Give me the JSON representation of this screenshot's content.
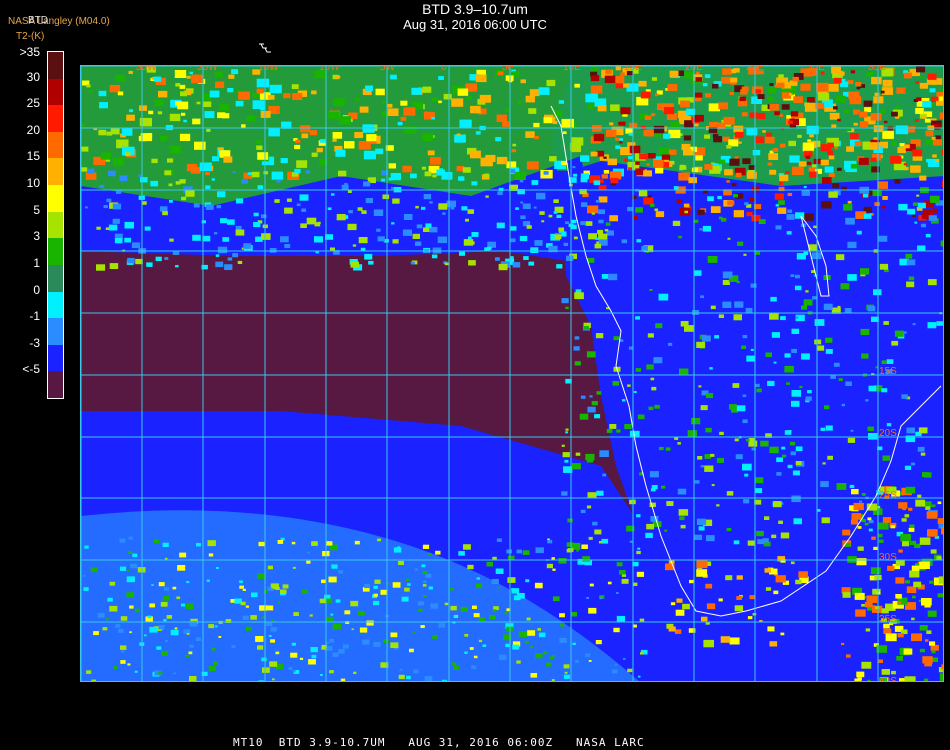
{
  "header": {
    "title": "BTD 3.9–10.7um",
    "subtitle": "Aug 31, 2016 06:00 UTC",
    "org": "NASA Langley (M04.0)",
    "btd_label": "BTD",
    "units": "T2-(K)"
  },
  "legend": {
    "bins": [
      {
        "label": ">35",
        "color": "#5a0f10"
      },
      {
        "label": "30",
        "color": "#b00000"
      },
      {
        "label": "25",
        "color": "#ff1a00"
      },
      {
        "label": "20",
        "color": "#ff6a00"
      },
      {
        "label": "15",
        "color": "#ffb000"
      },
      {
        "label": "10",
        "color": "#ffff00"
      },
      {
        "label": "5",
        "color": "#a6e300"
      },
      {
        "label": "3",
        "color": "#19b400"
      },
      {
        "label": "1",
        "color": "#2a8a5a"
      },
      {
        "label": "0",
        "color": "#00f0ff"
      },
      {
        "label": "-1",
        "color": "#2a8cff"
      },
      {
        "label": "-3",
        "color": "#1a22ff"
      },
      {
        "label": "<-5",
        "color": "#571842"
      }
    ]
  },
  "map": {
    "lon_labels": [
      "35W",
      "30W",
      "15W",
      "10W",
      "5W",
      "0",
      "5E",
      "10E",
      "15E",
      "20E",
      "25E",
      "30E",
      "35E"
    ],
    "lat_labels": [
      "15S",
      "20S",
      "25S",
      "30S",
      "35S",
      "40S"
    ],
    "colors": {
      "grid": "#39c9e8",
      "background": "#571842",
      "ocean_cloud": "#1a22ff",
      "coast": "#ffffff"
    }
  },
  "footer": {
    "text": "MT10  BTD 3.9-10.7UM   AUG 31, 2016 06:00Z   NASA LARC"
  }
}
